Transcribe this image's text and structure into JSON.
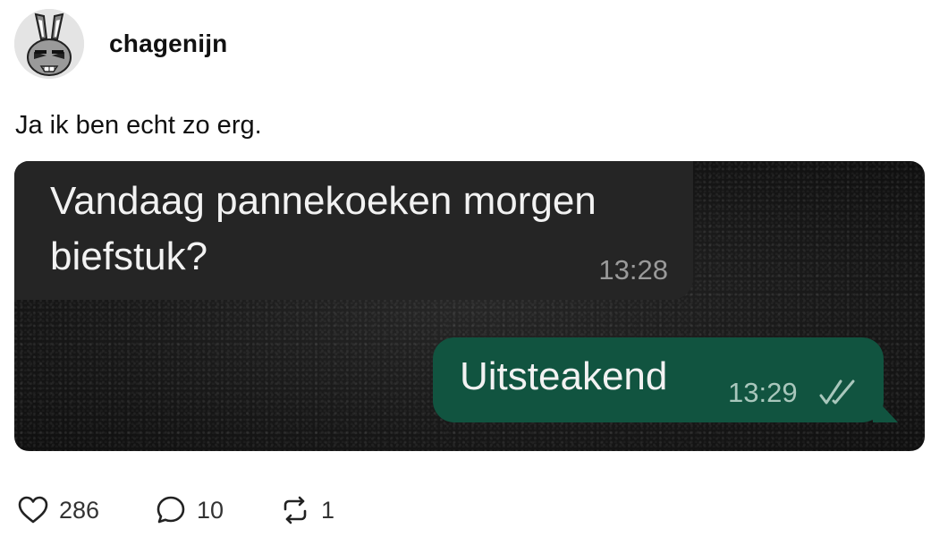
{
  "post": {
    "username": "chagenijn",
    "caption": "Ja ik ben echt zo erg."
  },
  "chat": {
    "incoming": {
      "text": "Vandaag pannekoeken morgen biefstuk?",
      "time": "13:28"
    },
    "outgoing": {
      "text": "Uitsteakend",
      "time": "13:29",
      "status_icon": "double-check-icon"
    }
  },
  "actions": {
    "likes": "286",
    "replies": "10",
    "reposts": "1"
  },
  "colors": {
    "outgoing_bubble": "#115440",
    "incoming_bubble": "#252525",
    "chat_background": "#141414"
  }
}
